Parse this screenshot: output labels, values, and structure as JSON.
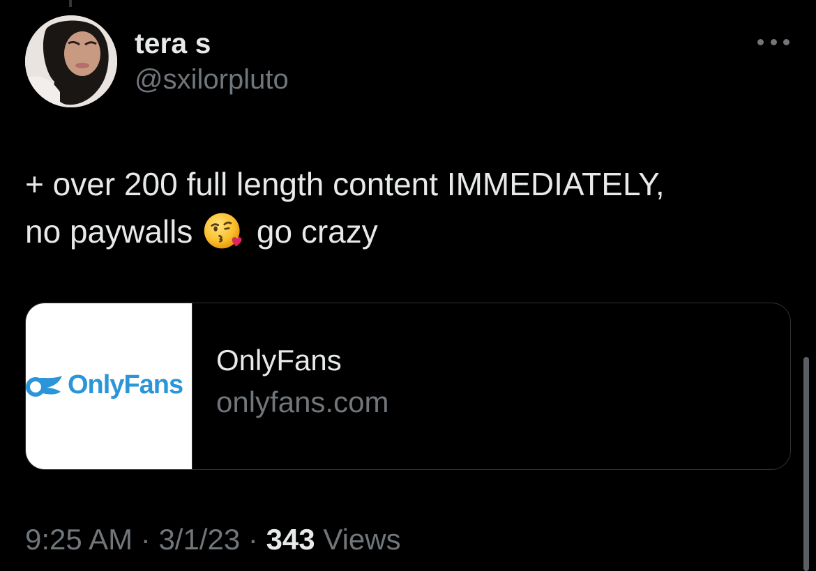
{
  "author": {
    "name": "tera s",
    "handle": "@sxilorpluto"
  },
  "tweet": {
    "line1": "+ over 200 full length content IMMEDIATELY,",
    "line2_before": "no paywalls",
    "emoji": "face-blowing-a-kiss",
    "line2_after": "go crazy"
  },
  "link_card": {
    "thumbnail_logo_text": "OnlyFans",
    "title": "OnlyFans",
    "domain": "onlyfans.com"
  },
  "meta": {
    "time": "9:25 AM",
    "sep1": "·",
    "date": "3/1/23",
    "sep2": "·",
    "views_count": "343",
    "views_label": "Views"
  },
  "colors": {
    "background": "#000000",
    "text_primary": "#e7e9ea",
    "text_secondary": "#71767b",
    "onlyfans_blue": "#2a95d8"
  }
}
